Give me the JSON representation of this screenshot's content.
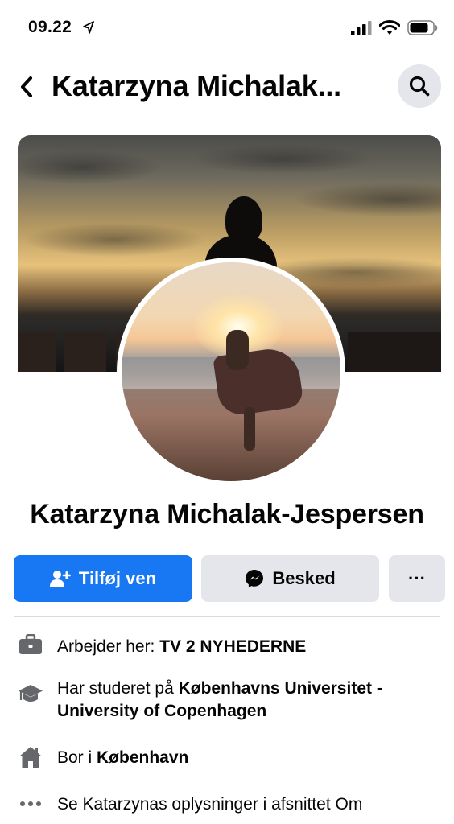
{
  "status_bar": {
    "time": "09.22"
  },
  "header": {
    "title": "Katarzyna Michalak..."
  },
  "profile": {
    "name": "Katarzyna Michalak-Jespersen"
  },
  "actions": {
    "add_friend_label": "Tilføj ven",
    "message_label": "Besked",
    "more_label": "···"
  },
  "details": {
    "work": {
      "prefix": "Arbejder her: ",
      "value": "TV 2 NYHEDERNE"
    },
    "education": {
      "prefix": "Har studeret på ",
      "value": "Københavns Universitet - University of Copenhagen"
    },
    "home": {
      "prefix": "Bor i ",
      "value": "København"
    },
    "about": {
      "text": "Se Katarzynas oplysninger i afsnittet Om"
    }
  },
  "colors": {
    "primary": "#1877f2",
    "secondary_bg": "#e4e6eb",
    "text": "#050505",
    "icon": "#65676b"
  },
  "icons": {
    "location_arrow": "location-arrow-icon",
    "signal": "signal-icon",
    "wifi": "wifi-icon",
    "battery": "battery-icon",
    "back": "chevron-left-icon",
    "search": "search-icon",
    "add_friend": "add-friend-icon",
    "messenger": "messenger-icon",
    "work": "briefcase-icon",
    "education": "graduation-cap-icon",
    "home": "home-icon",
    "about": "more-dots-icon"
  }
}
